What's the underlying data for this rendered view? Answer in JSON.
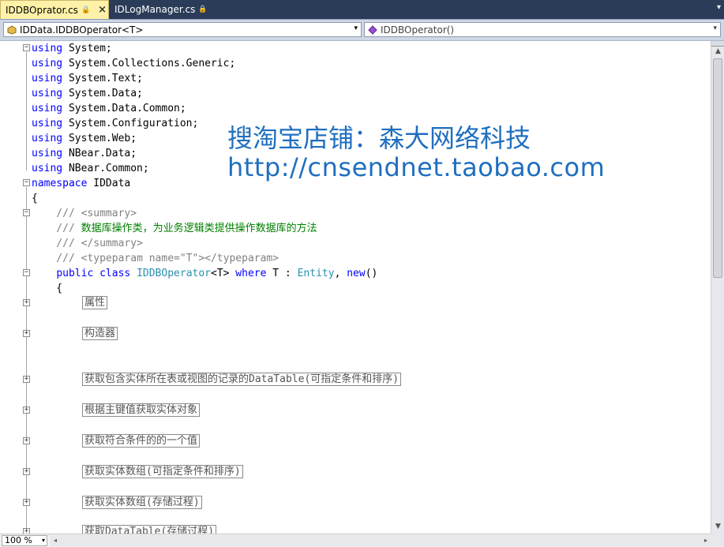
{
  "tabs": [
    {
      "label": "IDDBOprator.cs",
      "lock": "🔒",
      "close": "×"
    },
    {
      "label": "IDLogManager.cs",
      "lock": "🔒"
    }
  ],
  "tab_dropdown": "▾",
  "nav": {
    "left_value": "IDData.IDDBOperator<T>",
    "right_value": "IDDBOperator()",
    "arrow": "▾"
  },
  "code": {
    "usings": [
      [
        "using",
        " System;"
      ],
      [
        "using",
        " System.Collections.Generic;"
      ],
      [
        "using",
        " System.Text;"
      ],
      [
        "using",
        " System.Data;"
      ],
      [
        "using",
        " System.Data.Common;"
      ],
      [
        "using",
        " System.Configuration;"
      ],
      [
        "using",
        " System.Web;"
      ],
      [
        "using",
        " NBear.Data;"
      ],
      [
        "using",
        " NBear.Common;"
      ]
    ],
    "namespace_kw": "namespace",
    "namespace_name": " IDData",
    "open_brace": "{",
    "doc_slashes": "    ///",
    "summary_open": " <summary>",
    "summary_text": " 数据库操作类，为业务逻辑类提供操作数据库的方法",
    "summary_close": " </summary>",
    "typeparam": " <typeparam name=\"T\"></typeparam>",
    "class_indent": "    ",
    "class_public": "public",
    "class_class": " class",
    "class_name": " IDDBOperator",
    "class_t": "<T>",
    "class_where": " where",
    "class_t2": " T : ",
    "class_entity": "Entity",
    "class_comma": ", ",
    "class_new": "new",
    "class_parens": "()",
    "class_brace": "    {"
  },
  "regions": [
    "属性",
    "构造器",
    "获取包含实体所在表或视图的记录的DataTable(可指定条件和排序)",
    "根据主键值获取实体对象",
    "获取符合条件的的一个值",
    "获取实体数组(可指定条件和排序)",
    "获取实体数组(存储过程)",
    "获取DataTable(存储过程)"
  ],
  "watermark": {
    "line1": "搜淘宝店铺：森大网络科技",
    "line2": "http://cnsendnet.taobao.com"
  },
  "status": {
    "zoom": "100 %",
    "zoom_arrow": "▾",
    "left_arrow": "◂",
    "right_arrow": "▸"
  },
  "colors": {
    "keyword": "#0000ff",
    "type": "#2b91af",
    "comment": "#008000",
    "xml_doc": "#808080",
    "watermark": "#1f6fbf",
    "active_tab": "#fff2a8",
    "tabbar": "#2b3c59"
  }
}
